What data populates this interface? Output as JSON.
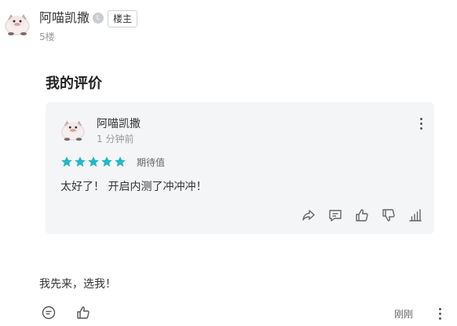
{
  "comment": {
    "author": "阿喵凯撒",
    "level_badge": "L",
    "op_badge": "楼主",
    "floor": "5楼",
    "review_section_title": "我的评价",
    "review": {
      "reviewer": "阿喵凯撒",
      "time": "1 分钟前",
      "stars": 5,
      "rating_label": "期待值",
      "text": "太好了！ 开启内测了冲冲冲！",
      "star_color": "#22b8c7"
    },
    "post_text": "我先来，选我！",
    "post_time": "刚刚"
  },
  "icons": {
    "card_actions": [
      "share-icon",
      "comment-icon",
      "like-icon",
      "dislike-icon",
      "stats-icon"
    ],
    "post_actions": [
      "comment-icon",
      "like-icon"
    ]
  }
}
